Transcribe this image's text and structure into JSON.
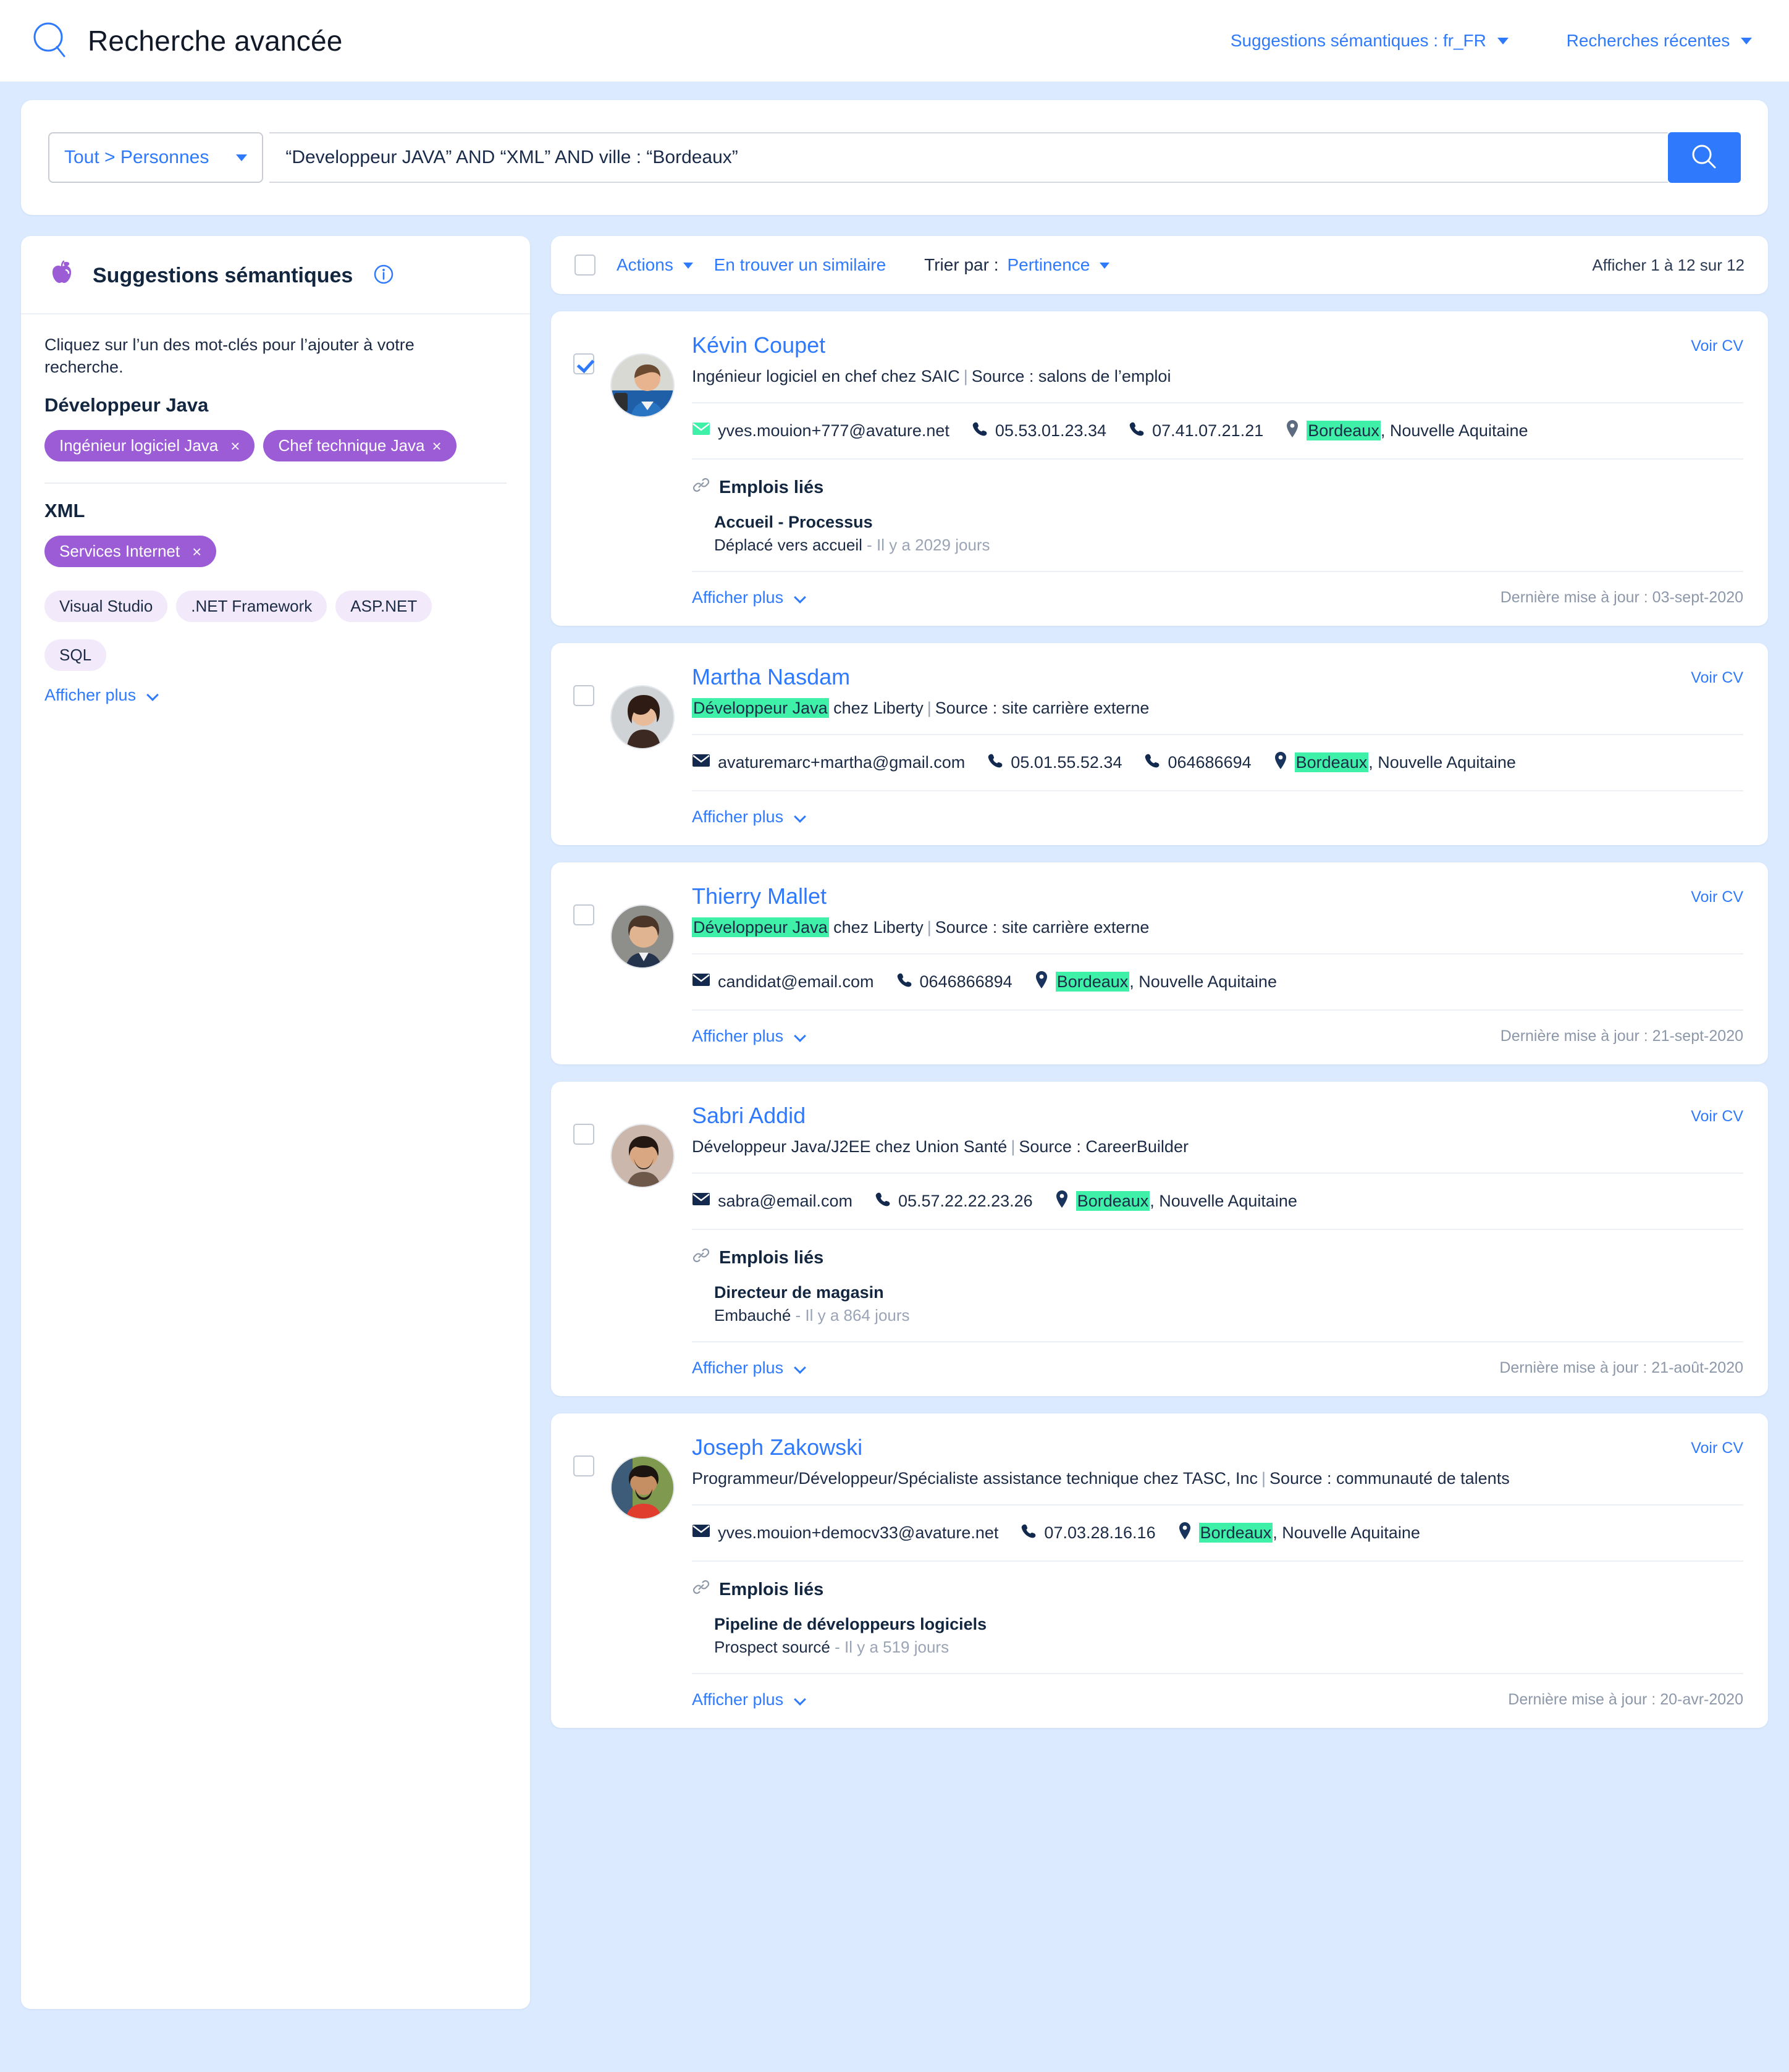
{
  "header": {
    "title": "Recherche avancée",
    "logo_icon": "search-circle-icon",
    "links": [
      {
        "label": "Suggestions sémantiques : fr_FR",
        "icon": "chevron-down-icon"
      },
      {
        "label": "Recherches récentes",
        "icon": "chevron-down-icon"
      }
    ]
  },
  "search": {
    "scope_label": "Tout > Personnes",
    "scope_icon": "chevron-down-icon",
    "query": "“Developpeur JAVA” AND “XML” AND ville : “Bordeaux”",
    "placeholder": "",
    "submit_icon": "search-icon",
    "accent": "#2f7afc"
  },
  "sidebar": {
    "icon": "apple-icon",
    "title": "Suggestions sémantiques",
    "info_icon": "info-icon",
    "hint": "Cliquez sur l’un des mot-clés pour l’ajouter à votre recherche.",
    "groups": [
      {
        "title": "Développeur Java",
        "chips": [
          {
            "label": "Ingénieur logiciel Java",
            "selected": true,
            "remove_icon": "close-icon"
          },
          {
            "label": "Chef technique Java",
            "selected": true,
            "remove_icon": "close-icon"
          }
        ]
      },
      {
        "title": "XML",
        "chips": [
          {
            "label": "Services Internet",
            "selected": true,
            "remove_icon": "close-icon"
          },
          {
            "label": "Visual Studio",
            "selected": false
          },
          {
            "label": ".NET Framework",
            "selected": false
          },
          {
            "label": "ASP.NET",
            "selected": false
          },
          {
            "label": "SQL",
            "selected": false
          }
        ]
      }
    ],
    "show_more": "Afficher plus",
    "show_more_icon": "chevron-down-icon",
    "chip_selected_color": "#9b5cd6",
    "chip_plain_color": "#f2e9fb"
  },
  "toolbar": {
    "select_all_checked": false,
    "actions_label": "Actions",
    "actions_icon": "chevron-down-icon",
    "find_similar_label": "En trouver un similaire",
    "sort_label": "Trier par :",
    "sort_value": "Pertinence",
    "sort_icon": "chevron-down-icon",
    "count_label": "Afficher 1 à 12 sur 12"
  },
  "common": {
    "cv_link": "Voir CV",
    "show_more": "Afficher plus",
    "show_more_icon": "chevron-down-icon",
    "jobs_title": "Emplois liés",
    "jobs_icon": "link-icon",
    "email_icon": "envelope-icon",
    "phone_icon": "phone-icon",
    "location_icon": "map-pin-icon",
    "highlight_color": "#3ef0a8"
  },
  "results": [
    {
      "checked": true,
      "avatar": "photo-man-blue-jacket",
      "name": "Kévin Coupet",
      "subtitle_plain": "Ingénieur logiciel en chef chez SAIC",
      "subtitle_highlight": "",
      "subtitle_rest": "",
      "source": "Source : salons de l’emploi",
      "email": "yves.mouion+777@avature.net",
      "email_highlighted": true,
      "phones": [
        "05.53.01.23.34",
        "07.41.07.21.21"
      ],
      "city": "Bordeaux",
      "region": ", Nouvelle Aquitaine",
      "jobs": [
        {
          "name": "Accueil - Processus",
          "status": "Déplacé vers accueil",
          "age": "- Il y a 2029 jours"
        }
      ],
      "updated": "Dernière mise à jour : 03-sept-2020"
    },
    {
      "checked": false,
      "avatar": "photo-woman-dark-hair",
      "name": "Martha Nasdam",
      "subtitle_plain": "",
      "subtitle_highlight": "Développeur Java",
      "subtitle_rest": " chez Liberty",
      "source": "Source : site carrière externe",
      "email": "avaturemarc+martha@gmail.com",
      "email_highlighted": false,
      "phones": [
        "05.01.55.52.34",
        "064686694"
      ],
      "city": "Bordeaux",
      "region": ", Nouvelle Aquitaine",
      "jobs": [],
      "updated": ""
    },
    {
      "checked": false,
      "avatar": "photo-man-suit",
      "name": "Thierry Mallet",
      "subtitle_plain": "",
      "subtitle_highlight": "Développeur Java",
      "subtitle_rest": " chez Liberty",
      "source": "Source : site carrière externe",
      "email": "candidat@email.com",
      "email_highlighted": false,
      "phones": [
        "0646866894"
      ],
      "city": "Bordeaux",
      "region": ", Nouvelle Aquitaine",
      "jobs": [],
      "updated": "Dernière mise à jour : 21-sept-2020"
    },
    {
      "checked": false,
      "avatar": "photo-man-beard",
      "name": "Sabri Addid",
      "subtitle_plain": "Développeur Java/J2EE chez Union Santé",
      "subtitle_highlight": "",
      "subtitle_rest": "",
      "source": "Source : CareerBuilder",
      "email": "sabra@email.com",
      "email_highlighted": false,
      "phones": [
        "05.57.22.22.23.26"
      ],
      "city": "Bordeaux",
      "region": ", Nouvelle Aquitaine",
      "jobs": [
        {
          "name": "Directeur de magasin",
          "status": "Embauché",
          "age": "- Il y a 864 jours"
        }
      ],
      "updated": "Dernière mise à jour : 21-août-2020"
    },
    {
      "checked": false,
      "avatar": "photo-man-red-shirt",
      "name": "Joseph Zakowski",
      "subtitle_plain": "Programmeur/Développeur/Spécialiste assistance technique chez TASC, Inc",
      "subtitle_highlight": "",
      "subtitle_rest": "",
      "source": "Source : communauté de talents",
      "email": "yves.mouion+democv33@avature.net",
      "email_highlighted": false,
      "phones": [
        "07.03.28.16.16"
      ],
      "city": "Bordeaux",
      "region": ", Nouvelle Aquitaine",
      "jobs": [
        {
          "name": "Pipeline de développeurs logiciels",
          "status": "Prospect sourcé",
          "age": "- Il y a 519 jours"
        }
      ],
      "updated": "Dernière mise à jour : 20-avr-2020"
    }
  ]
}
